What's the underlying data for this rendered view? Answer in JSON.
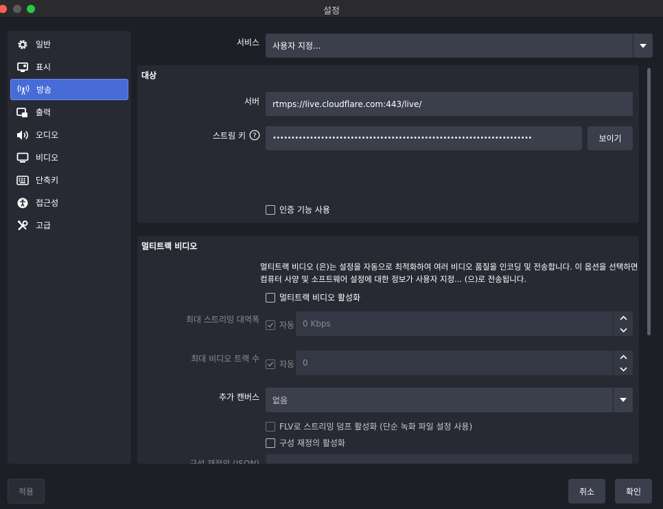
{
  "window": {
    "title": "설정"
  },
  "sidebar": {
    "items": [
      {
        "label": "일반",
        "icon": "gear-icon"
      },
      {
        "label": "표시",
        "icon": "display-icon"
      },
      {
        "label": "방송",
        "icon": "broadcast-icon",
        "active": true
      },
      {
        "label": "출력",
        "icon": "output-icon"
      },
      {
        "label": "오디오",
        "icon": "audio-icon"
      },
      {
        "label": "비디오",
        "icon": "video-icon"
      },
      {
        "label": "단축키",
        "icon": "keyboard-icon"
      },
      {
        "label": "접근성",
        "icon": "accessibility-icon"
      },
      {
        "label": "고급",
        "icon": "tools-icon"
      }
    ]
  },
  "service": {
    "label": "서비스",
    "value": "사용자 지정..."
  },
  "destination": {
    "title": "대상",
    "server_label": "서버",
    "server_value": "rtmps://live.cloudflare.com:443/live/",
    "key_label": "스트림 키",
    "key_value": "••••••••••••••••••••••••••••••••••••••••••••••••••••••••••••••••••••••",
    "show_button": "보이기",
    "auth_checkbox": "인증 기능 사용"
  },
  "multitrack": {
    "title": "멀티트랙 비디오",
    "description_line1": "멀티트랙 비디오 (은)는 설정을 자동으로 최적화하여 여러 비디오 품질을 인코딩 및 전송합니다. 이 옵션을 선택하면",
    "description_line2": "컴퓨터 사양 및 소프트웨어 설정에 대한 정보가 사용자 지정... (으)로 전송됩니다.",
    "enable_checkbox": "멀티트랙 비디오 활성화",
    "max_bitrate_label": "최대 스트리밍 대역폭",
    "auto_label_1": "자동",
    "max_bitrate_value": "0 Kbps",
    "max_tracks_label": "최대 비디오 트랙 수",
    "auto_label_2": "자동",
    "max_tracks_value": "0",
    "extra_canvas_label": "추가 캔버스",
    "extra_canvas_value": "없음",
    "flv_checkbox": "FLV로 스트리밍 덤프 활성화 (단순 녹화 파일 설정 사용)",
    "config_override_checkbox": "구성 재정의 활성화",
    "config_override_label": "구성 재정의 (JSON)"
  },
  "footer": {
    "apply": "적용",
    "cancel": "취소",
    "ok": "확인"
  },
  "colors": {
    "accent": "#476bd7",
    "panel": "#272a33",
    "field": "#3b3e4b",
    "background": "#1d1f26"
  }
}
